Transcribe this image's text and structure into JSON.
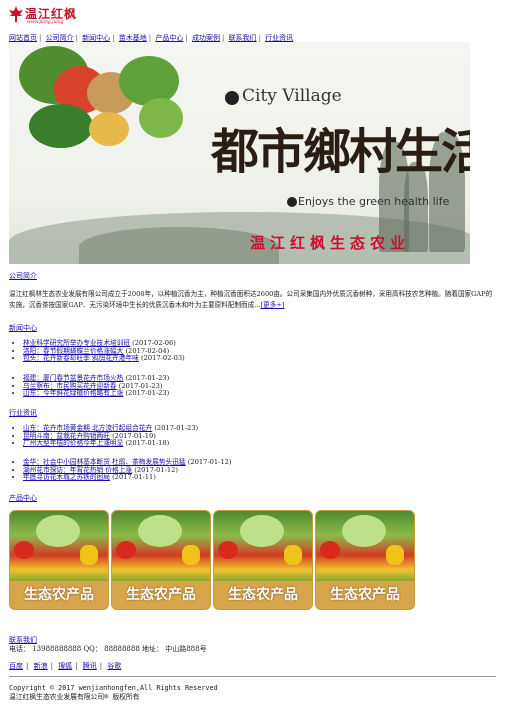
{
  "logo": {
    "name": "温江红枫",
    "url": "www.jiang.jiang"
  },
  "nav": [
    "网站首页",
    "公司简介",
    "新闻中心",
    "苗木基地",
    "产品中心",
    "成功案例",
    "联系我们",
    "行业资讯"
  ],
  "banner": {
    "city_village": "City Village",
    "headline": "都市鄉村生活",
    "enjoy": "Enjoys the green health life",
    "slogan": "温江红枫生态农业"
  },
  "about": {
    "title": "公司简介",
    "text": "温江红枫林生态农业发展有限公司成立于2008年，以种植沉香为主，种植沉香面积达2600亩。公司采集国内外优质沉香树种，采用高科技农艺种植。随着国家GAP的实施，沉香茶按国家GAP、无污染环境中生长的优质沉香木和叶为主要原料配制而成...",
    "more": "[更多+]"
  },
  "news": {
    "title": "新闻中心",
    "group1": [
      {
        "title": "林业科学研究所举办专业技术培训班",
        "date": "(2017-02-06)"
      },
      {
        "title": "洛阳：春节假期蝴蝶兰价格涨幅大",
        "date": "(2017-02-04)"
      },
      {
        "title": "包头：花卉新春却旺季 鸦鸽花卉港年味",
        "date": "(2017-02-03)"
      }
    ],
    "group2": [
      {
        "title": "福建：厦门春节盆景花卉市场火热",
        "date": "(2017-01-23)"
      },
      {
        "title": "乌兰察布：市民购买花卉迎新春",
        "date": "(2017-01-23)"
      },
      {
        "title": "山东：今年鲜花绿植价格略有上涨",
        "date": "(2017-01-23)"
      }
    ]
  },
  "industry": {
    "title": "行业资讯",
    "group1": [
      {
        "title": "山东：花卉市场黄金期 北方流行起组合花卉",
        "date": "(2017-01-23)"
      },
      {
        "title": "昆明斗南：盆栽花卉购销两旺",
        "date": "(2017-01-19)"
      },
      {
        "title": "广州大型年桔的价格今年上涨明显",
        "date": "(2017-01-18)"
      }
    ],
    "group2": [
      {
        "title": "金华：社会中小园林基本断货 杜鹃、茶梅发展势头迅猛",
        "date": "(2017-01-12)"
      },
      {
        "title": "湖州花市探访：年宵花热销 价格上涨",
        "date": "(2017-01-12)"
      },
      {
        "title": "年底寻访花木城之苏铁的困局",
        "date": "(2017-01-11)"
      }
    ]
  },
  "products": {
    "title": "产品中心",
    "items": [
      "生态农产品",
      "生态农产品",
      "生态农产品",
      "生态农产品"
    ]
  },
  "contact": {
    "title": "联系我们",
    "line": "电话： 13988888888 QQ： 88888888 地址： 中山路888号"
  },
  "links": [
    "百度",
    "新浪",
    "搜狐",
    "腾讯",
    "谷歌"
  ],
  "footer": {
    "copyright": "Copyright © 2017 wenjianhongfen,All Rights Reserved",
    "company": "温江红枫生态农业发展有限公司® 版权所有"
  },
  "colors": {
    "brand_red": "#c8102e",
    "link": "#1a0dab"
  }
}
